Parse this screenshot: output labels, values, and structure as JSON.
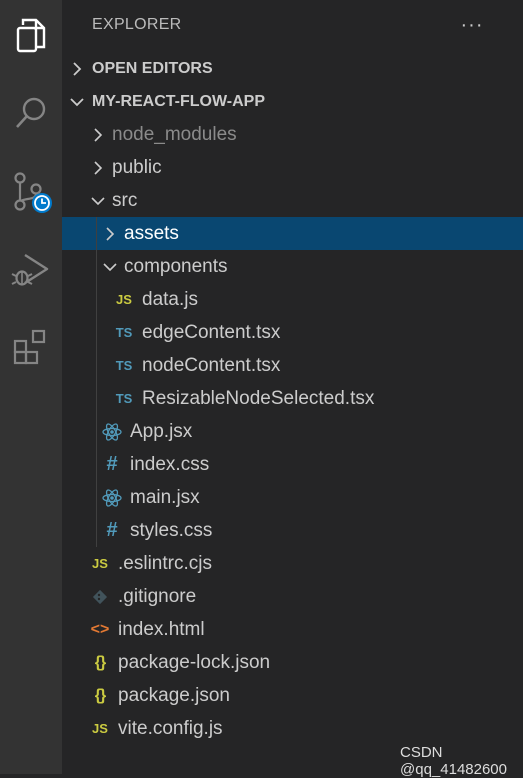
{
  "explorer": {
    "title": "EXPLORER",
    "more_label": "···",
    "open_editors_label": "OPEN EDITORS",
    "project_label": "MY-REACT-FLOW-APP"
  },
  "activity_bar": {
    "items": [
      {
        "name": "explorer-icon"
      },
      {
        "name": "search-icon"
      },
      {
        "name": "source-control-icon"
      },
      {
        "name": "run-debug-icon"
      },
      {
        "name": "extensions-icon"
      }
    ]
  },
  "tree": [
    {
      "label": "node_modules",
      "type": "folder",
      "state": "collapsed",
      "depth": 0,
      "dim": true
    },
    {
      "label": "public",
      "type": "folder",
      "state": "collapsed",
      "depth": 0
    },
    {
      "label": "src",
      "type": "folder",
      "state": "expanded",
      "depth": 0
    },
    {
      "label": "assets",
      "type": "folder",
      "state": "collapsed",
      "depth": 1,
      "selected": true
    },
    {
      "label": "components",
      "type": "folder",
      "state": "expanded",
      "depth": 1
    },
    {
      "label": "data.js",
      "type": "js",
      "icon": "JS",
      "depth": 2
    },
    {
      "label": "edgeContent.tsx",
      "type": "ts",
      "icon": "TS",
      "depth": 2
    },
    {
      "label": "nodeContent.tsx",
      "type": "ts",
      "icon": "TS",
      "depth": 2
    },
    {
      "label": "ResizableNodeSelected.tsx",
      "type": "ts",
      "icon": "TS",
      "depth": 2
    },
    {
      "label": "App.jsx",
      "type": "react",
      "depth": 1
    },
    {
      "label": "index.css",
      "type": "css",
      "icon": "#",
      "depth": 1
    },
    {
      "label": "main.jsx",
      "type": "react",
      "depth": 1
    },
    {
      "label": "styles.css",
      "type": "css",
      "icon": "#",
      "depth": 1
    },
    {
      "label": ".eslintrc.cjs",
      "type": "js",
      "icon": "JS",
      "depth": 0
    },
    {
      "label": ".gitignore",
      "type": "git",
      "depth": 0
    },
    {
      "label": "index.html",
      "type": "html",
      "icon": "<>",
      "depth": 0
    },
    {
      "label": "package-lock.json",
      "type": "json",
      "icon": "{}",
      "depth": 0
    },
    {
      "label": "package.json",
      "type": "json",
      "icon": "{}",
      "depth": 0
    },
    {
      "label": "vite.config.js",
      "type": "js",
      "icon": "JS",
      "depth": 0
    }
  ],
  "watermark": "CSDN @qq_41482600",
  "colors": {
    "activity_bar": "#333333",
    "sidebar": "#252526",
    "selection": "#094771",
    "js": "#cbcb41",
    "ts": "#519aba",
    "html": "#e37933",
    "react": "#519aba",
    "git": "#41535b"
  }
}
